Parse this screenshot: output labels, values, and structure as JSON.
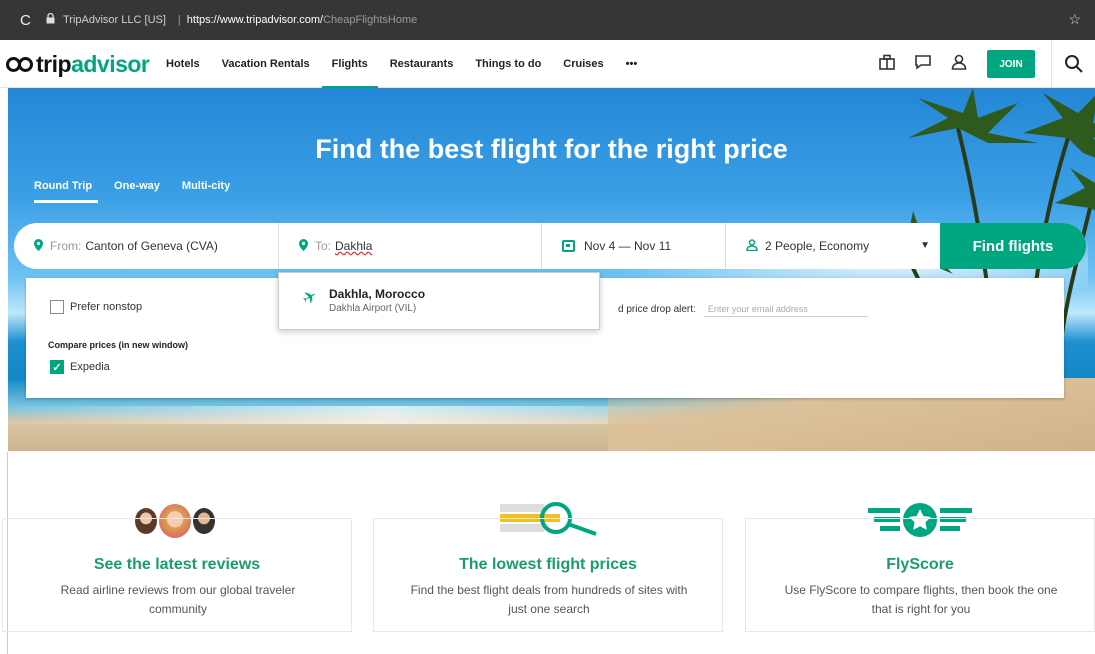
{
  "browser": {
    "site_label": "TripAdvisor LLC [US]",
    "url_host": "https://www.tripadvisor.com/",
    "url_path": "CheapFlightsHome",
    "reload_glyph": "C",
    "lock_icon": "lock-icon",
    "star_icon": "star-icon"
  },
  "nav": {
    "logo_part1": "trip",
    "logo_part2": "advisor",
    "links": [
      "Hotels",
      "Vacation Rentals",
      "Flights",
      "Restaurants",
      "Things to do",
      "Cruises",
      "•••"
    ],
    "active": "Flights",
    "join_label": "JOIN",
    "icons": [
      "suitcase-icon",
      "message-icon",
      "profile-icon",
      "search-icon"
    ]
  },
  "hero": {
    "title": "Find the best flight for the right price",
    "trip_types": [
      "Round Trip",
      "One-way",
      "Multi-city"
    ],
    "selected_trip": "Round Trip"
  },
  "search": {
    "from_label": "From:",
    "from_value": "Canton of Geneva (CVA)",
    "to_label": "To:",
    "to_value": "Dakhla",
    "dates": "Nov 4 — Nov 11",
    "passengers": "2 People, Economy",
    "find_label": "Find flights"
  },
  "options": {
    "prefer_nonstop": "Prefer nonstop",
    "compare_label": "Compare prices (in new window)",
    "expedia": "Expedia",
    "alert_label": "d price drop alert:",
    "alert_placeholder": "Enter your email address"
  },
  "suggestion": {
    "name": "Dakhla, Morocco",
    "sub": "Dakhla Airport (VIL)"
  },
  "features": [
    {
      "title": "See the latest reviews",
      "desc": "Read airline reviews from our global traveler community"
    },
    {
      "title": "The lowest flight prices",
      "desc": "Find the best flight deals from hundreds of sites with just one search"
    },
    {
      "title": "FlyScore",
      "desc": "Use FlyScore to compare flights, then book the one that is right for you"
    }
  ],
  "colors": {
    "brand": "#00a680",
    "feature_title": "#1a9c6e",
    "browser_bar": "#353638"
  }
}
